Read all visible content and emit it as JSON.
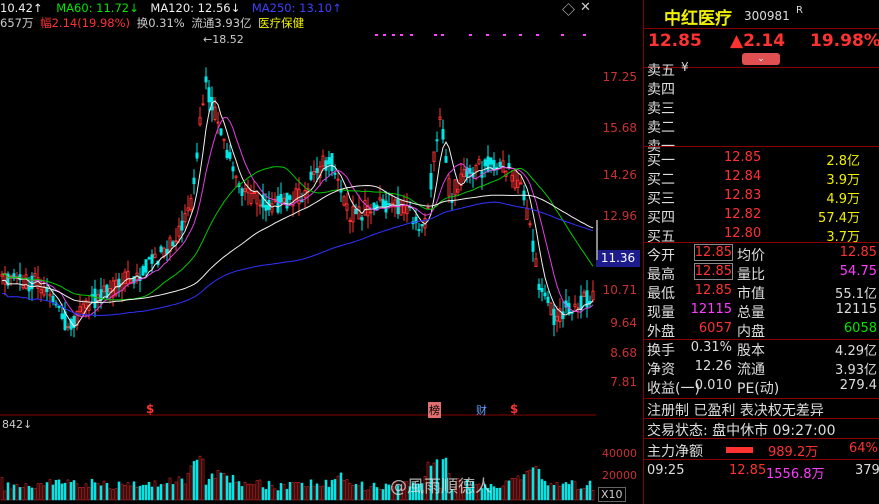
{
  "header": {
    "ma_values": [
      {
        "text": "10.42↑",
        "color": "#f0f0f0"
      },
      {
        "text": "MA60: 11.72↓",
        "color": "#00e600"
      },
      {
        "text": "MA120: 12.56↓",
        "color": "#f0f0f0"
      },
      {
        "text": "MA250: 13.10↑",
        "color": "#4040ff"
      }
    ],
    "line2": {
      "vol": "657万",
      "amp_label": "幅",
      "amp": "2.14(19.98%)",
      "turnover": "换0.31%",
      "float": "流通3.93亿",
      "sector": "医疗保健"
    }
  },
  "chart": {
    "peak_label": "18.52",
    "price_axis": [
      "17.25",
      "15.68",
      "14.26",
      "12.96",
      "11.36",
      "10.71",
      "9.64",
      "8.68",
      "7.81"
    ],
    "current_price_tag": "11.36",
    "event_markers": [
      {
        "text": "$",
        "kind": "dividend"
      },
      {
        "text": "榜",
        "kind": "rank"
      },
      {
        "text": "财",
        "kind": "finance"
      },
      {
        "text": "$",
        "kind": "dividend"
      }
    ],
    "volume_title": "842↓",
    "volume_axis": [
      "40000",
      "20000"
    ],
    "volume_unit": "X10",
    "watermark": "@風雨順德人"
  },
  "quote": {
    "name": "中红医疗",
    "code": "300981",
    "flag": "R",
    "price": "12.85",
    "change": "▲2.14",
    "change_pct": "19.98%",
    "sell": [
      {
        "label": "卖五",
        "price": "",
        "vol": "",
        "mark": "¥"
      },
      {
        "label": "卖四",
        "price": "",
        "vol": ""
      },
      {
        "label": "卖三",
        "price": "",
        "vol": ""
      },
      {
        "label": "卖二",
        "price": "",
        "vol": ""
      },
      {
        "label": "卖一",
        "price": "",
        "vol": ""
      }
    ],
    "buy": [
      {
        "label": "买一",
        "price": "12.85",
        "vol": "2.8亿"
      },
      {
        "label": "买二",
        "price": "12.84",
        "vol": "3.9万"
      },
      {
        "label": "买三",
        "price": "12.83",
        "vol": "4.9万"
      },
      {
        "label": "买四",
        "price": "12.82",
        "vol": "57.4万"
      },
      {
        "label": "买五",
        "price": "12.80",
        "vol": "3.7万"
      }
    ],
    "stats": [
      {
        "l1": "今开",
        "v1": "12.85",
        "c1": "red",
        "b1": true,
        "l2": "均价",
        "v2": "12.85",
        "c2": "red"
      },
      {
        "l1": "最高",
        "v1": "12.85",
        "c1": "red",
        "b1": true,
        "l2": "量比",
        "v2": "54.75",
        "c2": "mag"
      },
      {
        "l1": "最低",
        "v1": "12.85",
        "c1": "red",
        "b1": false,
        "l2": "市值",
        "v2": "55.1亿",
        "c2": "wht"
      },
      {
        "l1": "现量",
        "v1": "12115",
        "c1": "mag",
        "b1": false,
        "l2": "总量",
        "v2": "12115",
        "c2": "wht"
      },
      {
        "l1": "外盘",
        "v1": "6057",
        "c1": "red",
        "b1": false,
        "l2": "内盘",
        "v2": "6058",
        "c2": "grn"
      }
    ],
    "stats2": [
      {
        "l1": "换手",
        "v1": "0.31%",
        "l2": "股本",
        "v2": "4.29亿"
      },
      {
        "l1": "净资",
        "v1": "12.26",
        "l2": "流通",
        "v2": "3.93亿"
      },
      {
        "l1": "收益(一)",
        "v1": "0.010",
        "l2": "PE(动)",
        "v2": "279.4"
      }
    ],
    "info1": "注册制 已盈利 表决权无差异",
    "info2": "交易状态: 盘中休市 09:27:00",
    "main_flow_label": "主力净额",
    "main_flow_value": "989.2万",
    "main_flow_pct": "64%",
    "tick": {
      "time": "09:25",
      "price": "12.85",
      "amount": "1556.8万",
      "count": "379"
    }
  },
  "colors": {
    "up": "#ff3232",
    "down": "#00e6e6",
    "ma_white": "#f0f0f0",
    "ma_green": "#00c800",
    "ma_mag": "#e040e0",
    "ma_blue": "#3232ff"
  }
}
